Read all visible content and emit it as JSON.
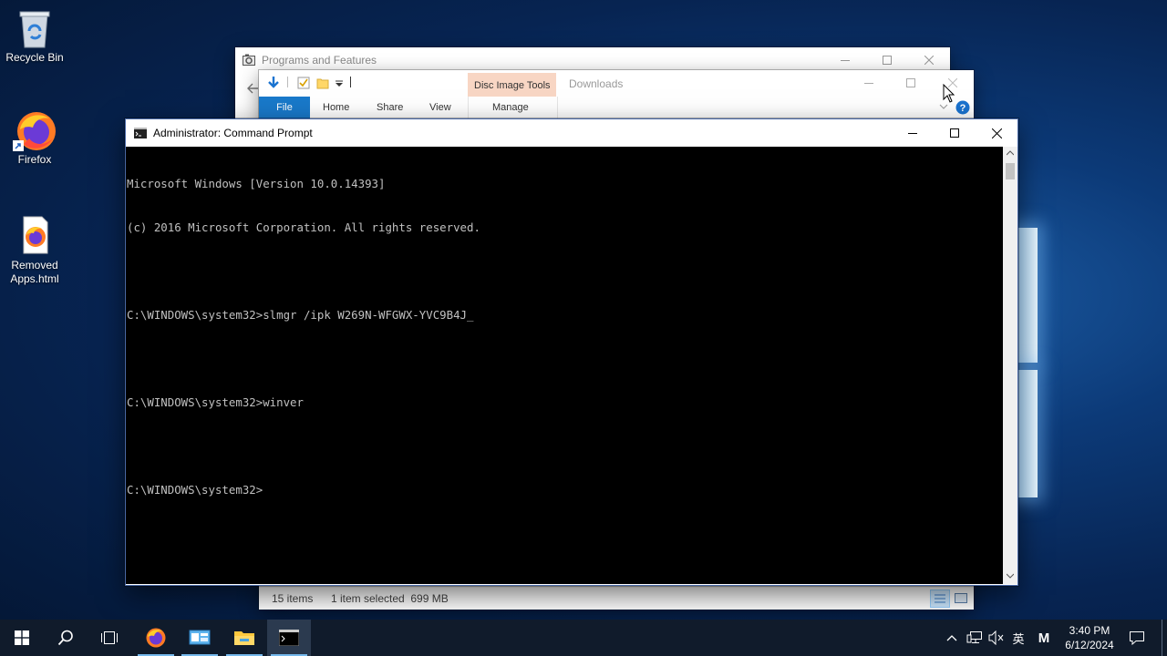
{
  "desktop": {
    "icons": [
      {
        "label": "Recycle Bin",
        "icon": "recycle-bin-icon"
      },
      {
        "label": "Firefox",
        "icon": "firefox-icon"
      },
      {
        "label": "Removed Apps.html",
        "icon": "firefox-html-file-icon",
        "label_line1": "Removed",
        "label_line2": "Apps.html"
      }
    ]
  },
  "programs_window": {
    "title": "Programs and Features"
  },
  "explorer_window": {
    "title": "Downloads",
    "context_tab": "Disc Image Tools",
    "tabs": [
      "File",
      "Home",
      "Share",
      "View",
      "Manage"
    ],
    "status": {
      "items": "15 items",
      "selection": "1 item selected  699 MB"
    },
    "accent_color": "#1979ca",
    "context_color": "#f8d6c4"
  },
  "cmd_window": {
    "title": "Administrator: Command Prompt",
    "lines": [
      "Microsoft Windows [Version 10.0.14393]",
      "(c) 2016 Microsoft Corporation. All rights reserved.",
      "",
      "C:\\WINDOWS\\system32>slmgr /ipk W269N-WFGWX-YVC9B4J_",
      "",
      "C:\\WINDOWS\\system32>winver",
      "",
      "C:\\WINDOWS\\system32>"
    ]
  },
  "taskbar": {
    "items": [
      "start-icon",
      "search-icon",
      "task-view-icon",
      "firefox-icon",
      "control-panel-icon",
      "file-explorer-icon",
      "command-prompt-icon"
    ],
    "tray": {
      "ime": "英",
      "ime_mode": "M",
      "time": "3:40 PM",
      "date": "6/12/2024"
    }
  }
}
